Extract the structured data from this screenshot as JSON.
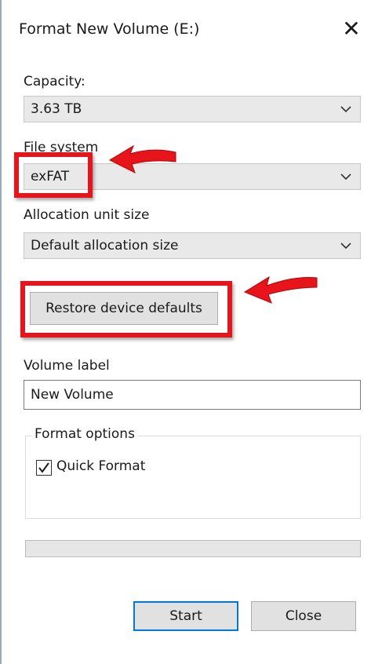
{
  "window": {
    "title": "Format New Volume (E:)",
    "close_glyph": "✕"
  },
  "capacity": {
    "label": "Capacity:",
    "value": "3.63 TB"
  },
  "file_system": {
    "label": "File system",
    "value": "exFAT"
  },
  "allocation": {
    "label": "Allocation unit size",
    "value": "Default allocation size"
  },
  "restore_button": {
    "label": "Restore device defaults"
  },
  "volume_label": {
    "label": "Volume label",
    "value": "New Volume"
  },
  "format_options": {
    "legend": "Format options",
    "quick_format_label": "Quick Format",
    "quick_format_checked": true
  },
  "progress": {
    "fraction": 0
  },
  "buttons": {
    "start": "Start",
    "close": "Close"
  },
  "colors": {
    "highlight": "#e8141c",
    "combo_background": "#e9e9e9",
    "button_background": "#e1e1e1",
    "default_button_border": "#0078d7"
  },
  "icons": {
    "dropdown": "chevron-down-icon",
    "window_close": "close-icon",
    "checkbox": "checkmark-icon",
    "annotation": "red-arrow-icon"
  }
}
